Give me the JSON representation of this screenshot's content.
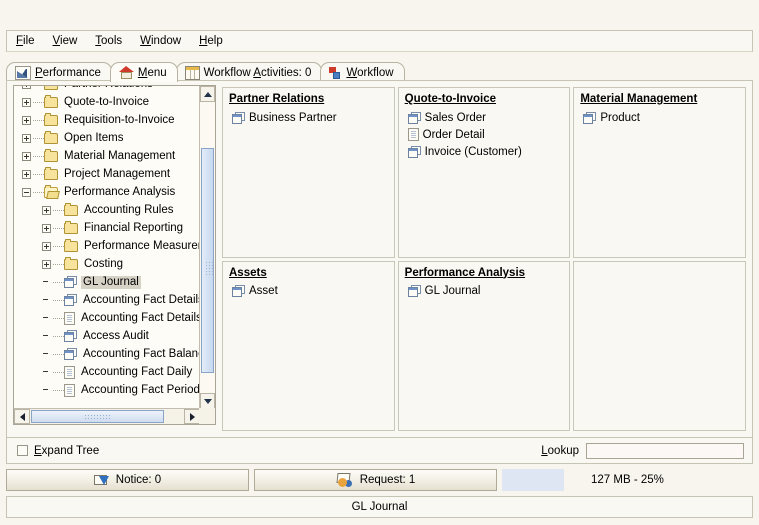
{
  "menubar": {
    "items": [
      {
        "label": "File",
        "mnemonic": "F"
      },
      {
        "label": "View",
        "mnemonic": "V"
      },
      {
        "label": "Tools",
        "mnemonic": "T"
      },
      {
        "label": "Window",
        "mnemonic": "W"
      },
      {
        "label": "Help",
        "mnemonic": "H"
      }
    ]
  },
  "tabs": [
    {
      "label": "Performance",
      "mnemonic": "P",
      "icon": "chart-icon",
      "active": false
    },
    {
      "label": "Menu",
      "mnemonic": "M",
      "icon": "home-icon",
      "active": true
    },
    {
      "label": "Workflow Activities: 0",
      "mnemonic": "A",
      "icon": "grid-icon",
      "active": false
    },
    {
      "label": "Workflow",
      "mnemonic": "W",
      "icon": "workflow-icon",
      "active": false
    }
  ],
  "tree": {
    "items": [
      {
        "label": "Partner Relations",
        "depth": 0,
        "expander": "plus",
        "icon": "folder-icon",
        "selected": false
      },
      {
        "label": "Quote-to-Invoice",
        "depth": 0,
        "expander": "plus",
        "icon": "folder-icon",
        "selected": false
      },
      {
        "label": "Requisition-to-Invoice",
        "depth": 0,
        "expander": "plus",
        "icon": "folder-icon",
        "selected": false
      },
      {
        "label": "Open Items",
        "depth": 0,
        "expander": "plus",
        "icon": "folder-icon",
        "selected": false
      },
      {
        "label": "Material Management",
        "depth": 0,
        "expander": "plus",
        "icon": "folder-icon",
        "selected": false
      },
      {
        "label": "Project Management",
        "depth": 0,
        "expander": "plus",
        "icon": "folder-icon",
        "selected": false
      },
      {
        "label": "Performance Analysis",
        "depth": 0,
        "expander": "minus",
        "icon": "folder-open-icon",
        "selected": false
      },
      {
        "label": "Accounting Rules",
        "depth": 1,
        "expander": "plus",
        "icon": "folder-icon",
        "selected": false
      },
      {
        "label": "Financial Reporting",
        "depth": 1,
        "expander": "plus",
        "icon": "folder-icon",
        "selected": false
      },
      {
        "label": "Performance Measuremen",
        "depth": 1,
        "expander": "plus",
        "icon": "folder-icon",
        "selected": false
      },
      {
        "label": "Costing",
        "depth": 1,
        "expander": "plus",
        "icon": "folder-icon",
        "selected": false
      },
      {
        "label": "GL Journal",
        "depth": 1,
        "expander": "none",
        "icon": "window-icon",
        "selected": true
      },
      {
        "label": "Accounting Fact Details",
        "depth": 1,
        "expander": "none",
        "icon": "window-icon",
        "selected": false
      },
      {
        "label": "Accounting Fact Details",
        "depth": 1,
        "expander": "none",
        "icon": "document-icon",
        "selected": false
      },
      {
        "label": "Access Audit",
        "depth": 1,
        "expander": "none",
        "icon": "window-icon",
        "selected": false
      },
      {
        "label": "Accounting Fact Balanc",
        "depth": 1,
        "expander": "none",
        "icon": "window-icon",
        "selected": false
      },
      {
        "label": "Accounting Fact Daily",
        "depth": 1,
        "expander": "none",
        "icon": "document-icon",
        "selected": false
      },
      {
        "label": "Accounting Fact Period",
        "depth": 1,
        "expander": "none",
        "icon": "document-icon",
        "selected": false
      }
    ]
  },
  "categories": [
    {
      "title": "Partner Relations",
      "items": [
        {
          "label": "Business Partner",
          "icon": "window-icon"
        }
      ]
    },
    {
      "title": "Quote-to-Invoice",
      "items": [
        {
          "label": "Sales Order",
          "icon": "window-icon"
        },
        {
          "label": "Order Detail",
          "icon": "document-icon"
        },
        {
          "label": "Invoice (Customer)",
          "icon": "window-icon"
        }
      ]
    },
    {
      "title": "Material Management",
      "items": [
        {
          "label": "Product",
          "icon": "window-icon"
        }
      ]
    },
    {
      "title": "Assets",
      "items": [
        {
          "label": "Asset",
          "icon": "window-icon"
        }
      ]
    },
    {
      "title": "Performance Analysis",
      "items": [
        {
          "label": "GL Journal",
          "icon": "window-icon"
        }
      ]
    },
    {
      "title": "",
      "items": []
    }
  ],
  "bottom": {
    "expand_tree_label": "Expand Tree",
    "expand_tree_mnemonic": "E",
    "expand_tree_checked": false,
    "lookup_label": "Lookup",
    "lookup_mnemonic": "L",
    "lookup_value": "",
    "lookup_placeholder": ""
  },
  "status": {
    "notice_label": "Notice: 0",
    "request_label": "Request: 1",
    "memory_label": "127 MB - 25%",
    "progress_percent": 25
  },
  "footer": {
    "message": "GL Journal"
  },
  "colors": {
    "background": "#f7f5ee",
    "panel": "#faf8f2",
    "field": "#fdfcf7",
    "border": "#c8c4b4",
    "selection": "#d6d2c6",
    "scroll_thumb": "#c6d8f0",
    "progress": "#dde6f2"
  }
}
